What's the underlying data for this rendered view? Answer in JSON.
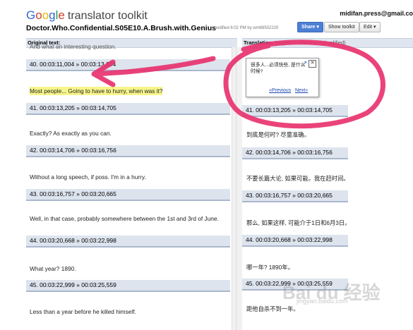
{
  "header": {
    "logo_letters": [
      "G",
      "o",
      "o",
      "g",
      "l",
      "e"
    ],
    "logo_rest": "translator toolkit",
    "user_email": "midifan.press@gmail.co",
    "doc_title": "Doctor.Who.Confidential.S05E10.A.Brush.with.Genius",
    "doc_meta": "modified 6:02 PM by wm69502220",
    "share_label": "Share ▾",
    "show_toolkit_label": "Show toolkit",
    "edit_label": "Edit ▾"
  },
  "columns": {
    "left_header": "Original text:",
    "right_header_label": "Translation:",
    "right_header_lang": "English » Chinese (Simplified)"
  },
  "original": {
    "partial_top": "And what an interesting question.",
    "items": [
      {
        "tc": "40. 00:03:11,004 » 00:03:13,204"
      },
      {
        "text": "Most people... Going to have to hurry, when was it?"
      },
      {
        "tc": "41. 00:03:13,205 » 00:03:14,705"
      },
      {
        "text": "Exactly? As exactly as you can."
      },
      {
        "tc": "42. 00:03:14,706 » 00:03:16,756"
      },
      {
        "text": "Without a long speech, if poss. I'm in a hurry."
      },
      {
        "tc": "43. 00:03:16,757 » 00:03:20,665"
      },
      {
        "text": "Well, in that case, probably somewhere between the 1st and 3rd of June."
      },
      {
        "tc": "44. 00:03:20,668 » 00:03:22,998"
      },
      {
        "text": "What year? 1890."
      },
      {
        "tc": "45. 00:03:22,999 » 00:03:25,559"
      },
      {
        "text": "Less than a year before he killed himself."
      }
    ]
  },
  "translation": {
    "items": [
      {
        "tc": "41. 00:03:13,205 » 00:03:14,705"
      },
      {
        "text": "到底是何时? 尽量准确。"
      },
      {
        "tc": "42. 00:03:14,706 » 00:03:16,756"
      },
      {
        "text": "不要长篇大论, 如果可能。我在赶时间。"
      },
      {
        "tc": "43. 00:03:16,757 » 00:03:20,665"
      },
      {
        "text": "那么, 如果这样, 可能介于1日和6月3日。"
      },
      {
        "tc": "44. 00:03:20,668 » 00:03:22,998"
      },
      {
        "text": "哪一年? 1890年。"
      },
      {
        "tc": "45. 00:03:22,999 » 00:03:25,559"
      },
      {
        "text": "距他自杀不到一年。"
      }
    ]
  },
  "popup": {
    "text": "很多人...必须快些, 是什么时候?",
    "prev_label": "«Previous",
    "next_label": "Next»",
    "expand_icon": "↗",
    "close_icon": "✕"
  },
  "watermark": {
    "brand": "Bai du 经验",
    "url": "jingyan.baidu.com"
  },
  "colors": {
    "annotation": "#e8336f",
    "highlight": "#f7f58a",
    "timecode_bar": "#dde4ee",
    "share_button": "#4d7fd4"
  }
}
